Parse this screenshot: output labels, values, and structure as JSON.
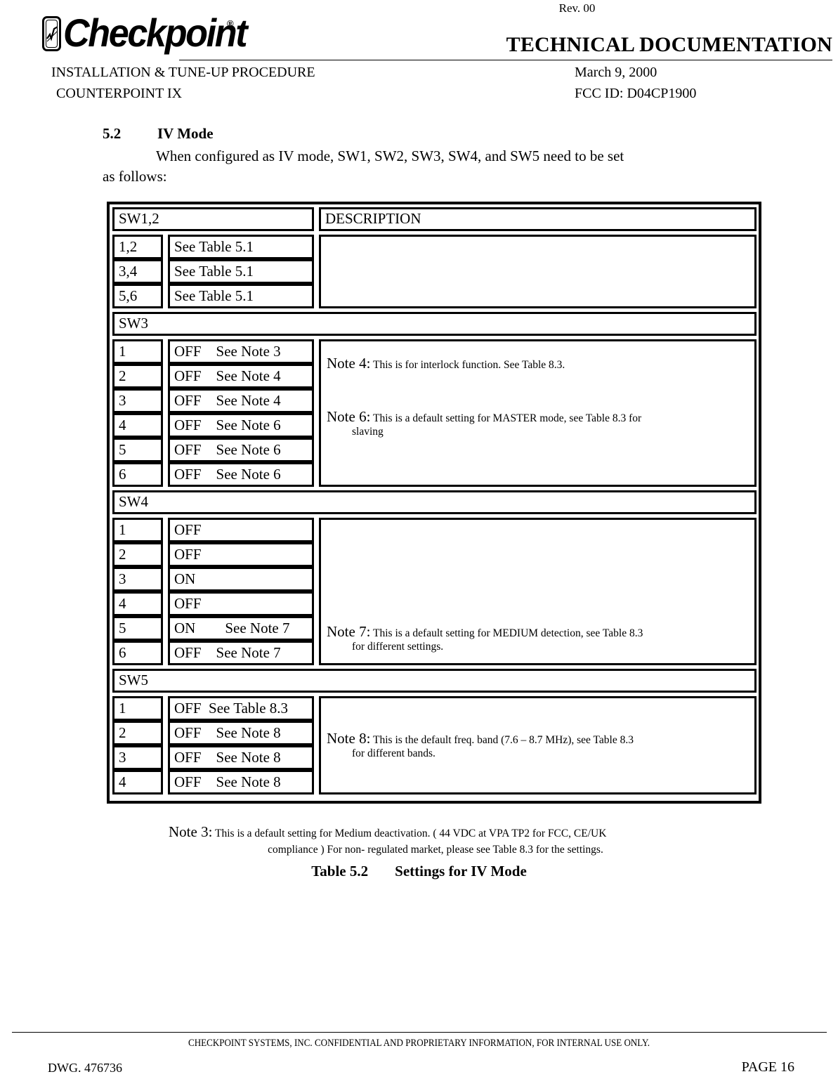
{
  "header": {
    "revision": "Rev. 00",
    "logo_word": "Checkpoint",
    "logo_registered": "®",
    "doc_type": "TECHNICAL DOCUMENTATION",
    "procedure_title": "INSTALLATION & TUNE-UP PROCEDURE",
    "product": "COUNTERPOINT IX",
    "date": "March 9, 2000",
    "fcc_id": "FCC ID: D04CP1900"
  },
  "section": {
    "number": "5.2",
    "title": "IV Mode",
    "body_line_1": "When configured as IV mode, SW1, SW2, SW3, SW4, and SW5 need to be set",
    "body_line_2": "as follows:"
  },
  "table": {
    "description_header": "DESCRIPTION",
    "blocks": [
      {
        "header": "SW1,2",
        "rows": [
          {
            "num": "1,2",
            "value": "See Table 5.1"
          },
          {
            "num": "3,4",
            "value": "See Table 5.1"
          },
          {
            "num": "5,6",
            "value": "See Table 5.1"
          }
        ],
        "notes": []
      },
      {
        "header": "SW3",
        "rows": [
          {
            "num": "1",
            "value": "OFF See Note 3"
          },
          {
            "num": "2",
            "value": "OFF See Note 4"
          },
          {
            "num": "3",
            "value": "OFF See Note 4"
          },
          {
            "num": "4",
            "value": "OFF See Note 6"
          },
          {
            "num": "5",
            "value": "OFF See Note 6"
          },
          {
            "num": "6",
            "value": "OFF See Note 6"
          }
        ],
        "notes": [
          {
            "label": "Note 4:",
            "text": "This is for interlock function. See Table 8.3.",
            "indent": ""
          },
          {
            "label": "Note 6:",
            "text": "This is a default setting for MASTER mode, see Table 8.3 for",
            "indent": "slaving"
          }
        ]
      },
      {
        "header": "SW4",
        "rows": [
          {
            "num": "1",
            "value": "OFF"
          },
          {
            "num": "2",
            "value": "OFF"
          },
          {
            "num": "3",
            "value": "ON"
          },
          {
            "num": "4",
            "value": "OFF"
          },
          {
            "num": "5",
            "value": "ON  See Note 7"
          },
          {
            "num": "6",
            "value": "OFF See Note 7"
          }
        ],
        "notes": [
          {
            "label": "Note 7:",
            "text": "This is a default setting for MEDIUM detection, see Table 8.3",
            "indent": "for different settings."
          }
        ]
      },
      {
        "header": "SW5",
        "rows": [
          {
            "num": "1",
            "value": "OFF See Table 8.3"
          },
          {
            "num": "2",
            "value": "OFF See Note 8"
          },
          {
            "num": "3",
            "value": "OFF See Note 8"
          },
          {
            "num": "4",
            "value": "OFF See Note 8"
          }
        ],
        "notes": [
          {
            "label": "Note 8:",
            "text": "This is the default freq. band (7.6 – 8.7 MHz), see Table 8.3",
            "indent": "for different bands."
          }
        ]
      }
    ]
  },
  "footnote": {
    "label": "Note 3:",
    "line_1": "This is a default setting for Medium deactivation. ( 44 VDC at VPA TP2 for FCC, CE/UK",
    "line_2": "compliance ) For non- regulated market, please see Table 8.3 for the settings."
  },
  "caption": {
    "number": "Table 5.2",
    "text": "Settings for IV Mode"
  },
  "footer": {
    "confidential": "CHECKPOINT SYSTEMS, INC. CONFIDENTIAL AND PROPRIETARY INFORMATION, FOR INTERNAL USE ONLY.",
    "drawing": "DWG.  476736",
    "page": "PAGE 16"
  }
}
